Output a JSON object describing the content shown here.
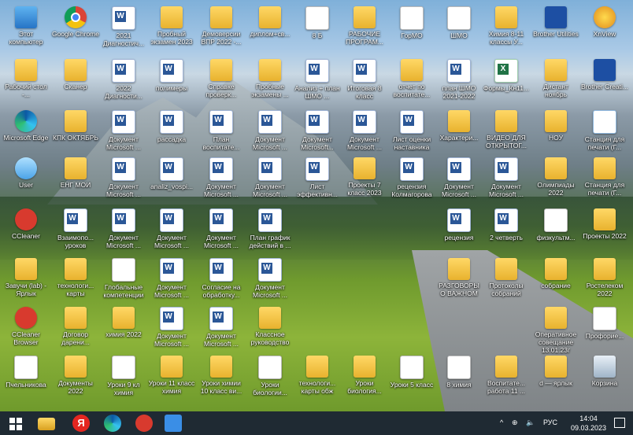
{
  "desktop": {
    "icons": [
      {
        "label": "Этот компьютер",
        "type": "pc"
      },
      {
        "label": "Google Chrome",
        "type": "chrome"
      },
      {
        "label": "2021 Диагностич...",
        "type": "word"
      },
      {
        "label": "Пробный экзамен 2023",
        "type": "folder"
      },
      {
        "label": "Демоверсии ВПР 2022 -...",
        "type": "folder"
      },
      {
        "label": "диплом+св...",
        "type": "folder"
      },
      {
        "label": "8 Б",
        "type": "doc"
      },
      {
        "label": "РАБОЧИЕ ПРОГРАМ...",
        "type": "folder"
      },
      {
        "label": "ГорМО",
        "type": "doc"
      },
      {
        "label": "ШМО",
        "type": "doc"
      },
      {
        "label": "Химия 8-11 классы У...",
        "type": "folder"
      },
      {
        "label": "Brother Utilities",
        "type": "brother"
      },
      {
        "label": "XnView",
        "type": "xnview"
      },
      {
        "label": "Рабочий стол -...",
        "type": "shortcut"
      },
      {
        "label": "Сканер",
        "type": "folder"
      },
      {
        "label": "2022 Диагности...",
        "type": "word"
      },
      {
        "label": "полимеры",
        "type": "word"
      },
      {
        "label": "Справке проверк...",
        "type": "folder"
      },
      {
        "label": "Пробные экзамены ...",
        "type": "folder"
      },
      {
        "label": "Анализ + план ШМО ...",
        "type": "word"
      },
      {
        "label": "Итоговая 8 класс",
        "type": "word"
      },
      {
        "label": "отчет по воспитате...",
        "type": "folder"
      },
      {
        "label": "план ШМО 2021-2022",
        "type": "word"
      },
      {
        "label": "Формы_Кн11...",
        "type": "excel"
      },
      {
        "label": "Дистант ноябрь",
        "type": "folder"
      },
      {
        "label": "Brother Creati...",
        "type": "brother"
      },
      {
        "label": "Microsoft Edge",
        "type": "edge"
      },
      {
        "label": "КПК ОКТЯБРЬ",
        "type": "folder"
      },
      {
        "label": "Документ Microsoft ...",
        "type": "word"
      },
      {
        "label": "рассадка",
        "type": "word"
      },
      {
        "label": "План воспитате...",
        "type": "word"
      },
      {
        "label": "Документ Microsoft ...",
        "type": "word"
      },
      {
        "label": "Документ Microsoft...",
        "type": "word"
      },
      {
        "label": "Документ Microsoft ...",
        "type": "word"
      },
      {
        "label": "Лист оценки наставника",
        "type": "word"
      },
      {
        "label": "Характери...",
        "type": "folder"
      },
      {
        "label": "ВИДЕО ДЛЯ ОТКРЫТОГ...",
        "type": "folder"
      },
      {
        "label": "НОУ",
        "type": "folder"
      },
      {
        "label": "Станция для печати (Г...",
        "type": "scanner"
      },
      {
        "label": "User",
        "type": "user"
      },
      {
        "label": "ЕНГ МОИ",
        "type": "folder"
      },
      {
        "label": "Документ Microsoft ...",
        "type": "word"
      },
      {
        "label": "analiz_vospi...",
        "type": "word"
      },
      {
        "label": "Документ Microsoft ...",
        "type": "word"
      },
      {
        "label": "Документ Microsoft ...",
        "type": "word"
      },
      {
        "label": "Лист эффективн...",
        "type": "word"
      },
      {
        "label": "Проекты 7 класс 2023",
        "type": "folder"
      },
      {
        "label": "рецензия Колмагорова",
        "type": "word"
      },
      {
        "label": "Документ Microsoft ...",
        "type": "word"
      },
      {
        "label": "Документ Microsoft ...",
        "type": "word"
      },
      {
        "label": "Олимпиады 2022",
        "type": "folder"
      },
      {
        "label": "Станция для печати (Г...",
        "type": "folder"
      },
      {
        "label": "CCleaner",
        "type": "ccleaner"
      },
      {
        "label": "Взаимопо... уроков",
        "type": "word"
      },
      {
        "label": "Документ Microsoft ...",
        "type": "word"
      },
      {
        "label": "Документ Microsoft ...",
        "type": "word"
      },
      {
        "label": "Документ Microsoft ...",
        "type": "word"
      },
      {
        "label": "План график действий в ...",
        "type": "word"
      },
      {
        "label": "рецензия",
        "type": "word"
      },
      {
        "label": "2 четверть",
        "type": "word"
      },
      {
        "label": "физкультм...",
        "type": "doc"
      },
      {
        "label": "Проекты 2022",
        "type": "folder"
      },
      {
        "label": "Завучи (lab) - Ярлык",
        "type": "shortcut"
      },
      {
        "label": "технологи... карты",
        "type": "folder"
      },
      {
        "label": "Глобальные компетенции",
        "type": "doc"
      },
      {
        "label": "Документ Microsoft ...",
        "type": "word"
      },
      {
        "label": "Согласие на обработку...",
        "type": "word"
      },
      {
        "label": "Документ Microsoft ...",
        "type": "word"
      },
      {
        "label": "РАЗГОВОРЫ О ВАЖНОМ",
        "type": "folder"
      },
      {
        "label": "Протоколы собраний",
        "type": "folder"
      },
      {
        "label": "собрание",
        "type": "folder"
      },
      {
        "label": "Ростелеком 2022",
        "type": "folder"
      },
      {
        "label": "CCleaner Browser",
        "type": "ccleaner"
      },
      {
        "label": "Договор дарени...",
        "type": "folder"
      },
      {
        "label": "химия 2022",
        "type": "folder"
      },
      {
        "label": "Документ Microsoft ...",
        "type": "word"
      },
      {
        "label": "Документ Microsoft ...",
        "type": "word"
      },
      {
        "label": "Классное руководство",
        "type": "folder"
      },
      {
        "label": "Оперативное совещание 13.01.23г",
        "type": "folder"
      },
      {
        "label": "Профориe...",
        "type": "doc"
      },
      {
        "label": "Пчельникова",
        "type": "doc"
      },
      {
        "label": "Документы 2022",
        "type": "folder"
      },
      {
        "label": "Уроки 9 кл химия",
        "type": "doc"
      },
      {
        "label": "Уроки 11 класс химия",
        "type": "folder"
      },
      {
        "label": "Уроки химии 10 класс ви...",
        "type": "folder"
      },
      {
        "label": "Уроки биологии...",
        "type": "doc"
      },
      {
        "label": "технологи... карты обж",
        "type": "folder"
      },
      {
        "label": "Уроки биология...",
        "type": "folder"
      },
      {
        "label": "Уроки 5 класс",
        "type": "doc"
      },
      {
        "label": "8 химия",
        "type": "doc"
      },
      {
        "label": "Воспитате... работа 11 ...",
        "type": "folder"
      },
      {
        "label": "d — ярлык",
        "type": "shortcut"
      },
      {
        "label": "Корзина",
        "type": "bin"
      }
    ]
  },
  "taskbar": {
    "lang": "РУС",
    "time": "14:04",
    "date": "09.03.2023",
    "tray_arrow": "^"
  }
}
